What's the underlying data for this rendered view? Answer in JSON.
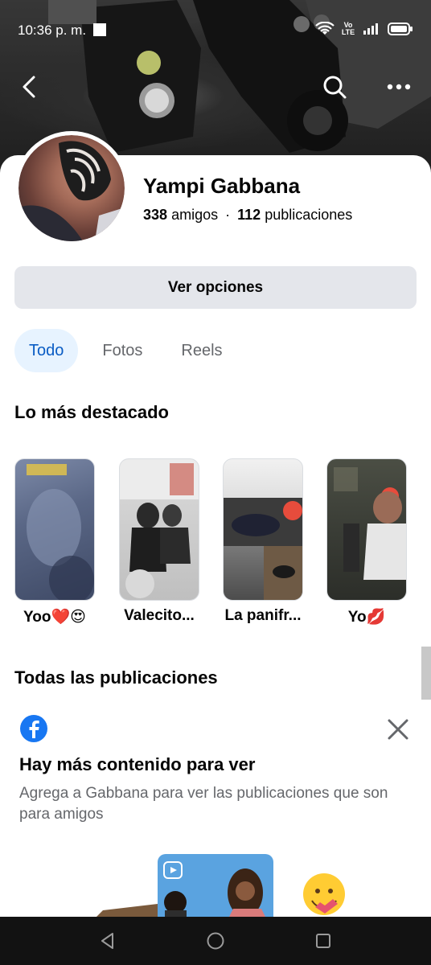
{
  "status_bar": {
    "time": "10:36 p. m.",
    "network": "Vo LTE"
  },
  "header": {
    "back_icon": "chevron-left-icon",
    "search_icon": "search-icon",
    "more_icon": "more-dots-icon"
  },
  "profile": {
    "name": "Yampi Gabbana",
    "friends_count": "338",
    "friends_label": "amigos",
    "separator": "·",
    "posts_count": "112",
    "posts_label": "publicaciones"
  },
  "options_button": "Ver opciones",
  "tabs": [
    {
      "label": "Todo",
      "active": true
    },
    {
      "label": "Fotos",
      "active": false
    },
    {
      "label": "Reels",
      "active": false
    }
  ],
  "highlights": {
    "title": "Lo más destacado",
    "items": [
      {
        "label": "Yoo❤️😍"
      },
      {
        "label": "Valecito..."
      },
      {
        "label": "La panifr..."
      },
      {
        "label": "Yo💋"
      }
    ]
  },
  "posts_section": {
    "title": "Todas las publicaciones"
  },
  "notice": {
    "title": "Hay más contenido para ver",
    "body": "Agrega a Gabbana para ver las publicaciones que son para amigos",
    "icon": "facebook-icon",
    "close_icon": "close-icon"
  },
  "colors": {
    "accent": "#0a5cc4",
    "tab_active_bg": "#e7f3ff",
    "button_bg": "#e4e6eb",
    "secondary_text": "#65676b",
    "facebook_blue": "#1877f2"
  }
}
